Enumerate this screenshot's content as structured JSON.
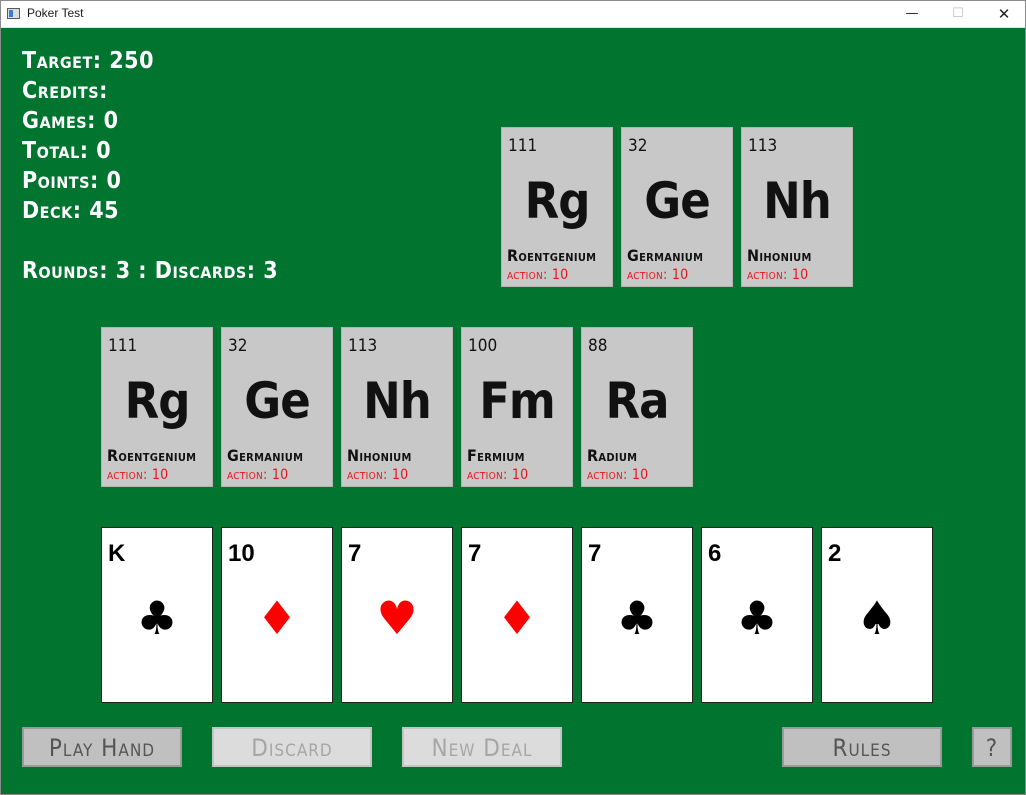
{
  "window": {
    "title": "Poker Test"
  },
  "stats": {
    "target": "Target: 250",
    "credits": "Credits:",
    "games": "Games: 0",
    "total": "Total: 0",
    "points": "Points: 0",
    "deck": "Deck: 45",
    "rounds": "Rounds: 3 : Discards: 3"
  },
  "top_elements": [
    {
      "number": "111",
      "symbol": "Rg",
      "name": "Roentgenium",
      "action": "action: 10"
    },
    {
      "number": "32",
      "symbol": "Ge",
      "name": "Germanium",
      "action": "action: 10"
    },
    {
      "number": "113",
      "symbol": "Nh",
      "name": "Nihonium",
      "action": "action: 10"
    }
  ],
  "mid_elements": [
    {
      "number": "111",
      "symbol": "Rg",
      "name": "Roentgenium",
      "action": "action: 10"
    },
    {
      "number": "32",
      "symbol": "Ge",
      "name": "Germanium",
      "action": "action: 10"
    },
    {
      "number": "113",
      "symbol": "Nh",
      "name": "Nihonium",
      "action": "action: 10"
    },
    {
      "number": "100",
      "symbol": "Fm",
      "name": "Fermium",
      "action": "action: 10"
    },
    {
      "number": "88",
      "symbol": "Ra",
      "name": "Radium",
      "action": "action: 10"
    }
  ],
  "cards": [
    {
      "rank": "K",
      "suit": "♣",
      "color": "black"
    },
    {
      "rank": "10",
      "suit": "♦",
      "color": "red"
    },
    {
      "rank": "7",
      "suit": "♥",
      "color": "red"
    },
    {
      "rank": "7",
      "suit": "♦",
      "color": "red"
    },
    {
      "rank": "7",
      "suit": "♣",
      "color": "black"
    },
    {
      "rank": "6",
      "suit": "♣",
      "color": "black"
    },
    {
      "rank": "2",
      "suit": "♠",
      "color": "black"
    }
  ],
  "buttons": {
    "play_hand": "Play Hand",
    "discard": "Discard",
    "new_deal": "New Deal",
    "rules": "Rules",
    "help": "?"
  },
  "colors": {
    "table_green": "#017530",
    "element_card_bg": "#c8c8c8",
    "action_red": "#e8151b",
    "suit_red": "#ff0000"
  }
}
